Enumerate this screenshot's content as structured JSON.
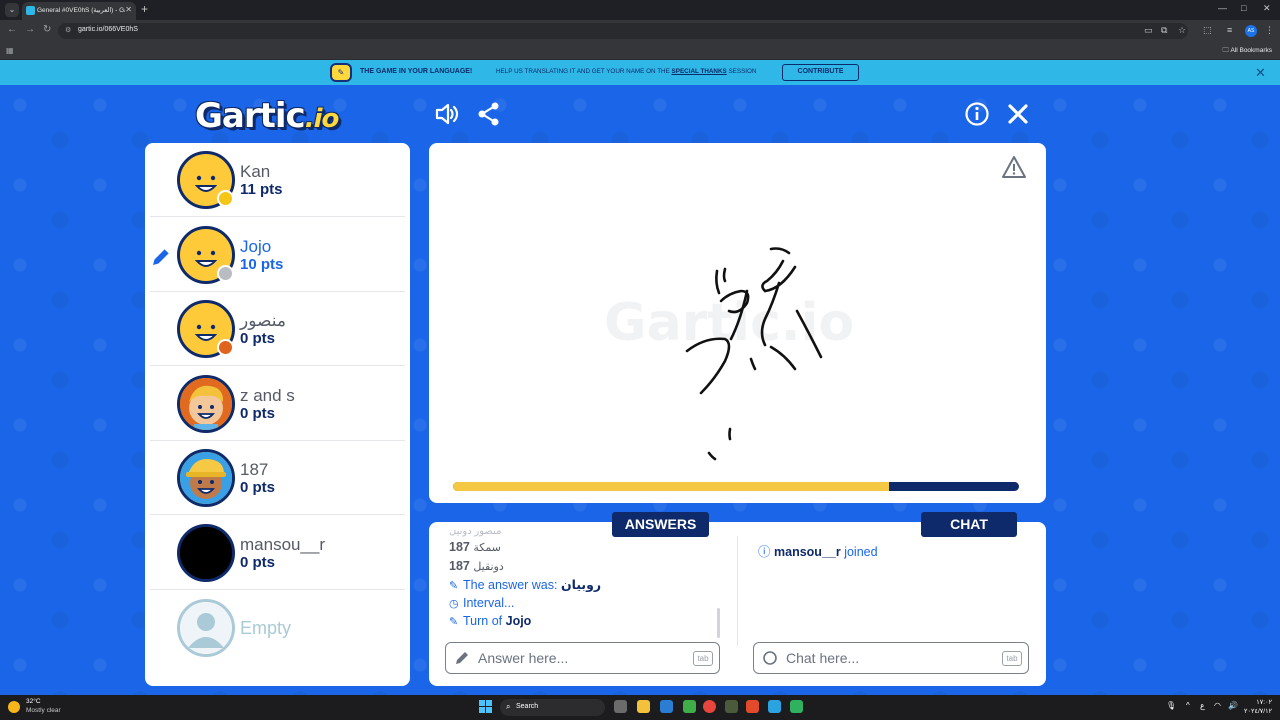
{
  "browser": {
    "tab_title": "General #0VE0hS (العربية) - Gar",
    "url": "gartic.io/066VE0hS",
    "all_bookmarks": "All Bookmarks",
    "profile_initials": "AS"
  },
  "banner": {
    "headline": "THE GAME IN YOUR LANGUAGE!",
    "text_before": "HELP US TRANSLATING IT AND GET YOUR NAME ON THE",
    "link": "SPECIAL THANKS",
    "text_after": "SESSION",
    "button": "CONTRIBUTE"
  },
  "logo": {
    "main": "Gartic",
    "suffix": ".io"
  },
  "players": [
    {
      "name": "Kan",
      "pts": "11 pts",
      "status_color": "#f5c518",
      "active": false,
      "avatar": "yellow"
    },
    {
      "name": "Jojo",
      "pts": "10 pts",
      "status_color": "#b9bcc3",
      "active": true,
      "avatar": "yellow"
    },
    {
      "name": "منصور",
      "pts": "0 pts",
      "status_color": "#e0641b",
      "active": false,
      "avatar": "yellow"
    },
    {
      "name": "z and s",
      "pts": "0 pts",
      "status_color": "",
      "active": false,
      "avatar": "blonde"
    },
    {
      "name": "187",
      "pts": "0 pts",
      "status_color": "",
      "active": false,
      "avatar": "cap"
    },
    {
      "name": "mansou__r",
      "pts": "0 pts",
      "status_color": "",
      "active": false,
      "avatar": "black"
    },
    {
      "name": "Empty",
      "pts": "",
      "status_color": "",
      "active": false,
      "avatar": "empty"
    }
  ],
  "canvas": {
    "watermark": "Gartic.io",
    "timer_progress": 0.77
  },
  "answers": {
    "label": "ANSWERS",
    "faded": "منصور دونيل",
    "lines": [
      {
        "num": "187",
        "text": "سمكة"
      },
      {
        "num": "187",
        "text": "دونقيل"
      }
    ],
    "answer_prefix": "The answer was:",
    "answer_word": "روبيان",
    "interval": "Interval...",
    "turn_prefix": "Turn of",
    "turn_name": "Jojo",
    "placeholder": "Answer here...",
    "key_hint": "tab"
  },
  "chat": {
    "label": "CHAT",
    "joined_name": "mansou__r",
    "joined_text": "joined",
    "placeholder": "Chat here...",
    "key_hint": "tab"
  },
  "taskbar": {
    "temp": "32°C",
    "weather": "Mostly clear",
    "search": "Search",
    "time": "١٧:٠٢",
    "date": "٢٠٢٤/٧/١٢"
  }
}
